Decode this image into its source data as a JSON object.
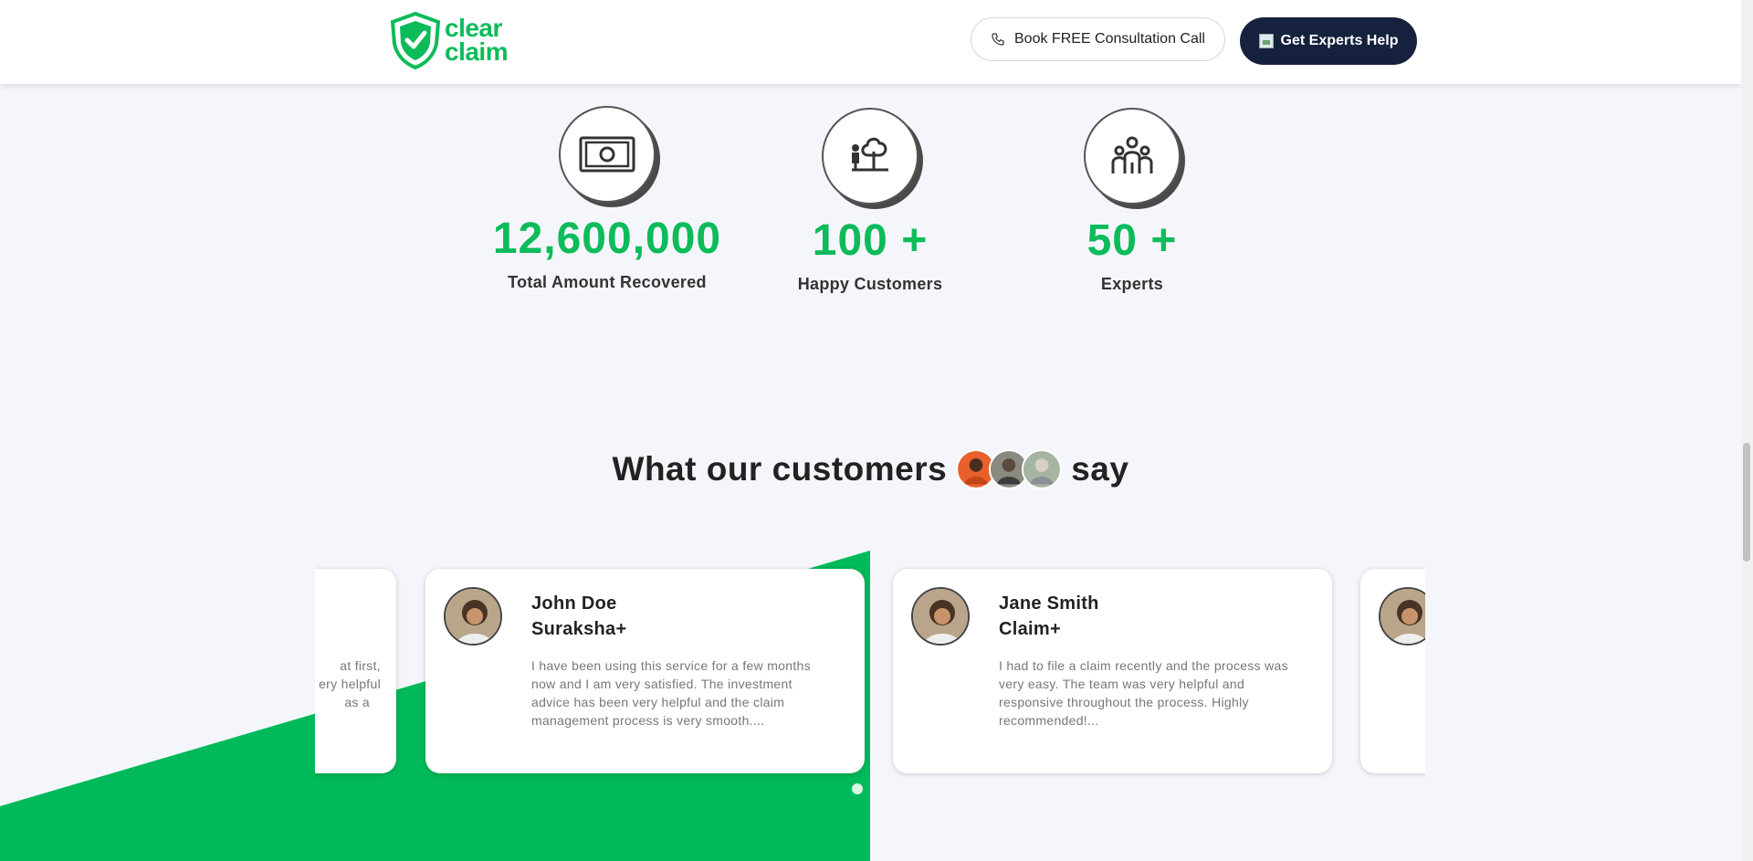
{
  "header": {
    "logo_line1": "clear",
    "logo_line2": "claim",
    "consult_label": "Book FREE Consultation Call",
    "experts_label": "Get Experts Help"
  },
  "stats": [
    {
      "value": "12,600,000",
      "label": "Total Amount Recovered",
      "icon": "cash-icon"
    },
    {
      "value": "100 +",
      "label": "Happy Customers",
      "icon": "person-tree-icon"
    },
    {
      "value": "50 +",
      "label": "Experts",
      "icon": "group-icon"
    }
  ],
  "testimonials": {
    "title_before": "What our customers",
    "title_after": "say",
    "partial_card_text": [
      "at first,",
      "ery helpful",
      "as a"
    ],
    "cards": [
      {
        "name": "John Doe",
        "plan": "Suraksha+",
        "text": "I have been using this service for a few months now and I am very satisfied. The investment advice has been very helpful and the claim management process is very smooth...."
      },
      {
        "name": "Jane Smith",
        "plan": "Claim+",
        "text": "I had to file a claim recently and the process was very easy. The team was very helpful and responsive throughout the process. Highly recommended!..."
      }
    ]
  },
  "colors": {
    "brand_green": "#0dbb5a",
    "dark_navy": "#16213e",
    "background": "#f4f6fb"
  }
}
